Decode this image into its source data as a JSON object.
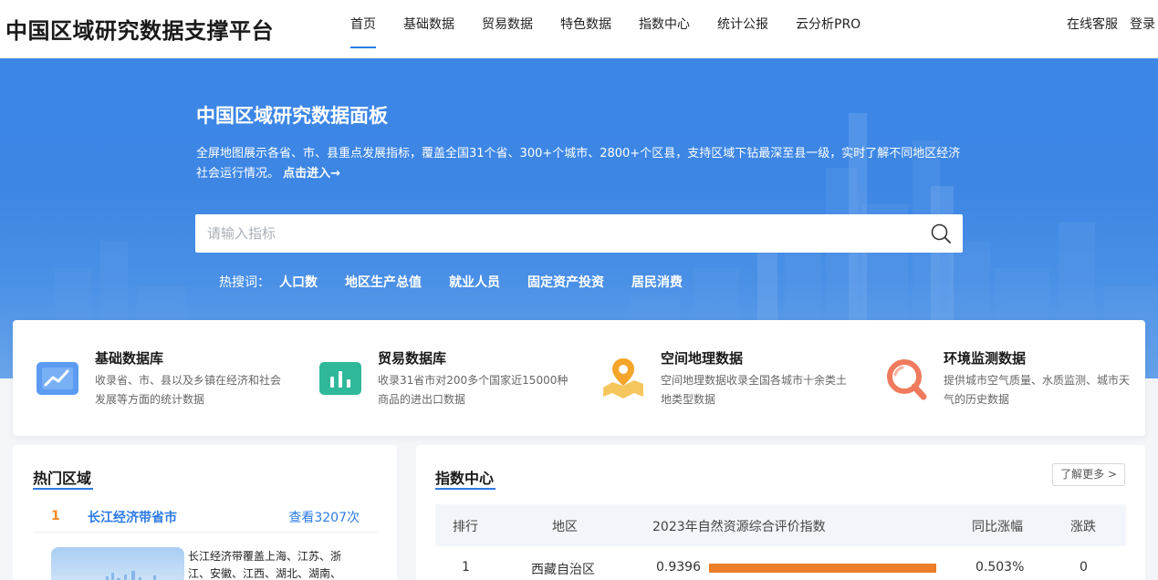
{
  "header": {
    "logo": "中国区域研究数据支撑平台",
    "nav": [
      {
        "label": "首页",
        "active": true
      },
      {
        "label": "基础数据",
        "active": false
      },
      {
        "label": "贸易数据",
        "active": false
      },
      {
        "label": "特色数据",
        "active": false
      },
      {
        "label": "指数中心",
        "active": false
      },
      {
        "label": "统计公报",
        "active": false
      },
      {
        "label": "云分析PRO",
        "active": false
      }
    ],
    "service": "在线客服",
    "login": "登录"
  },
  "hero": {
    "title": "中国区域研究数据面板",
    "description": "全屏地图展示各省、市、县重点发展指标，覆盖全国31个省、300+个城市、2800+个区县，支持区域下钻最深至县一级，实时了解不同地区经济社会运行情况。",
    "enter_link": "点击进入→",
    "search_placeholder": "请输入指标",
    "hot_label": "热搜词：",
    "hot_keywords": [
      "人口数",
      "地区生产总值",
      "就业人员",
      "固定资产投资",
      "居民消费"
    ]
  },
  "features": [
    {
      "title": "基础数据库",
      "desc": "收录省、市、县以及乡镇在经济和社会发展等方面的统计数据",
      "icon": "trend-chart-icon"
    },
    {
      "title": "贸易数据库",
      "desc": "收录31省市对200多个国家近15000种商品的进出口数据",
      "icon": "bar-chart-icon"
    },
    {
      "title": "空间地理数据",
      "desc": "空间地理数据收录全国各城市十余类土地类型数据",
      "icon": "map-pin-icon"
    },
    {
      "title": "环境监测数据",
      "desc": "提供城市空气质量、水质监测、城市天气的历史数据",
      "icon": "magnifier-icon"
    }
  ],
  "hot_regions": {
    "title": "热门区域",
    "items": [
      {
        "rank": "1",
        "name": "长江经济带省市",
        "views": "查看3207次",
        "desc": "长江经济带覆盖上海、江苏、浙江、安徽、江西、湖北、湖南、"
      }
    ]
  },
  "index_center": {
    "title": "指数中心",
    "more": "了解更多 >",
    "columns": [
      "排行",
      "地区",
      "2023年自然资源综合评价指数",
      "同比涨幅",
      "涨跌"
    ],
    "rows": [
      {
        "rank": "1",
        "region": "西藏自治区",
        "value": "0.9396",
        "bar_fraction": 0.9396,
        "change": "0.503%",
        "trend": "0"
      }
    ],
    "bar_color": "#ec7e2a"
  },
  "colors": {
    "accent": "#2d7be5",
    "hero_bg": "#3d86e4",
    "rank_orange": "#f08a24"
  }
}
